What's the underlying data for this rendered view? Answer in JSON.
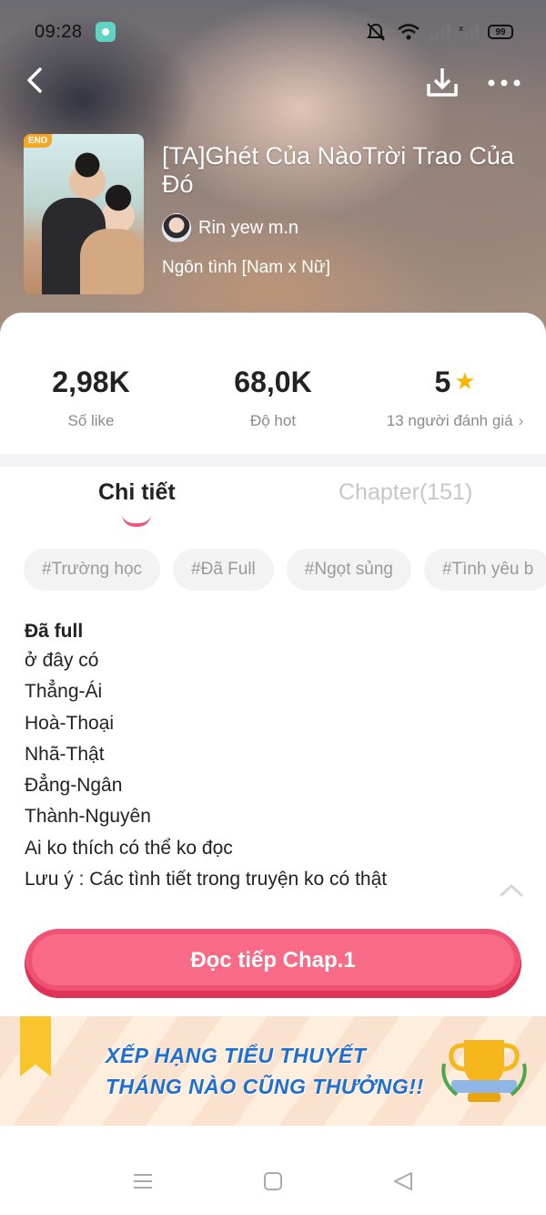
{
  "status_bar": {
    "time": "09:28",
    "battery": "99"
  },
  "book": {
    "badge": "END",
    "title": "[TA]Ghét Của NàoTrời Trao Của Đó",
    "author": "Rin yew m.n",
    "genre": "Ngôn tình [Nam x Nữ]"
  },
  "stats": [
    {
      "value": "2,98K",
      "label": "Số like"
    },
    {
      "value": "68,0K",
      "label": "Độ hot"
    },
    {
      "value": "5",
      "label": "13 người đánh giá"
    }
  ],
  "tabs": {
    "detail": "Chi tiết",
    "chapter": "Chapter(151)"
  },
  "tags": [
    "#Trường học",
    "#Đã Full",
    "#Ngọt sủng",
    "#Tình yêu b"
  ],
  "description": {
    "heading": "Đã full",
    "lines": [
      "ở đây có",
      "Thẳng-Ái",
      "Hoà-Thoại",
      "Nhã-Thật",
      "Đẳng-Ngân",
      "Thành-Nguyên",
      "Ai ko thích có thể ko đọc",
      "Lưu ý : Các tình tiết trong truyện ko có thật"
    ]
  },
  "read_button": "Đọc tiếp Chap.1",
  "banner": {
    "line1": "XẾP HẠNG TIỂU THUYẾT",
    "line2": "THÁNG NÀO CŨNG THƯỞNG!!"
  },
  "colors": {
    "accent": "#ef5373",
    "star": "#f8b500",
    "banner_text": "#1f6fd2"
  }
}
